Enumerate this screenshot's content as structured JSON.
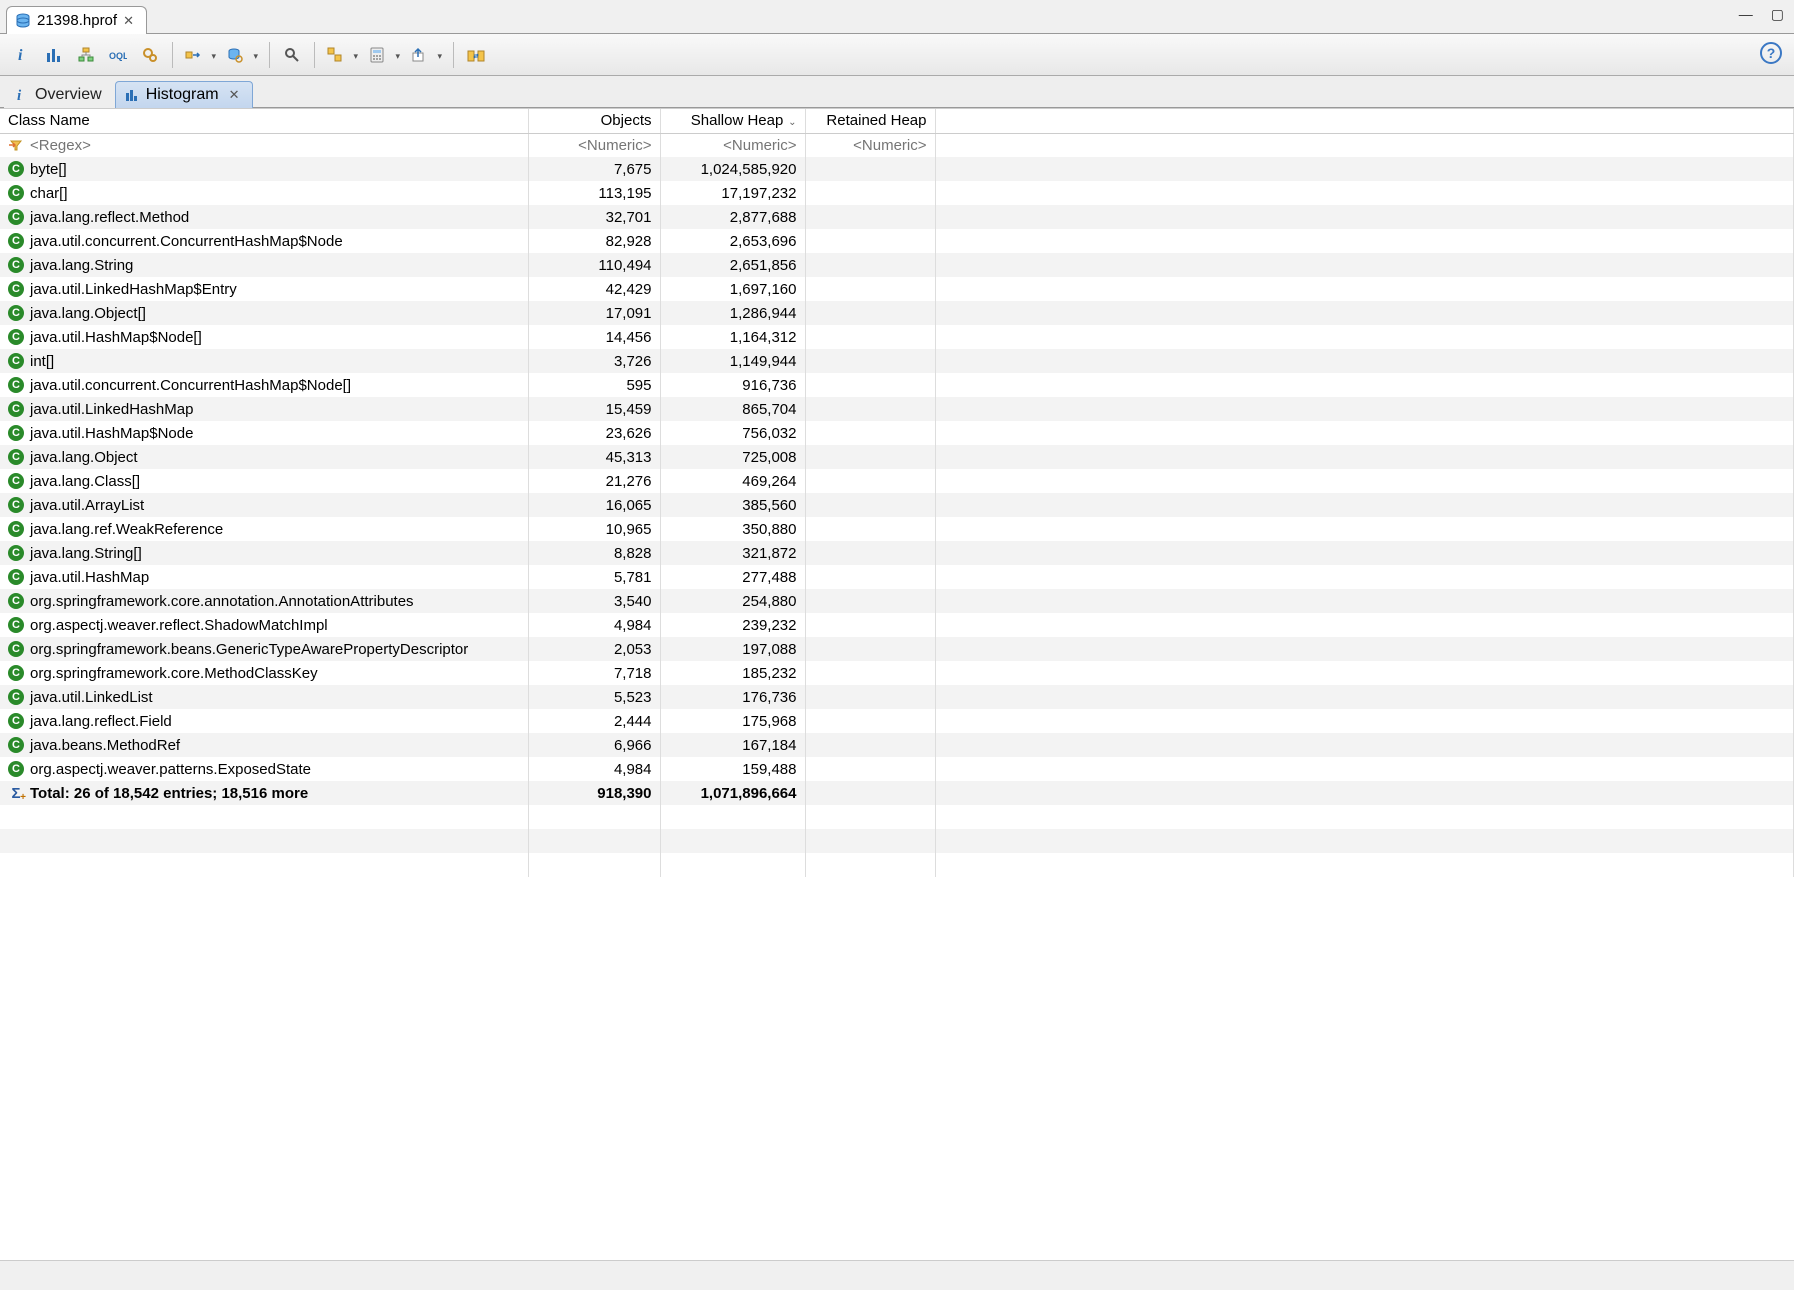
{
  "file_tab": {
    "title": "21398.hprof"
  },
  "subtabs": {
    "overview": "Overview",
    "histogram": "Histogram"
  },
  "columns": {
    "name": "Class Name",
    "objects": "Objects",
    "shallow": "Shallow Heap",
    "retained": "Retained Heap"
  },
  "filter": {
    "name_placeholder": "<Regex>",
    "numeric_placeholder": "<Numeric>"
  },
  "rows": [
    {
      "name": "byte[]",
      "objects": "7,675",
      "shallow": "1,024,585,920",
      "retained": ""
    },
    {
      "name": "char[]",
      "objects": "113,195",
      "shallow": "17,197,232",
      "retained": ""
    },
    {
      "name": "java.lang.reflect.Method",
      "objects": "32,701",
      "shallow": "2,877,688",
      "retained": ""
    },
    {
      "name": "java.util.concurrent.ConcurrentHashMap$Node",
      "objects": "82,928",
      "shallow": "2,653,696",
      "retained": ""
    },
    {
      "name": "java.lang.String",
      "objects": "110,494",
      "shallow": "2,651,856",
      "retained": ""
    },
    {
      "name": "java.util.LinkedHashMap$Entry",
      "objects": "42,429",
      "shallow": "1,697,160",
      "retained": ""
    },
    {
      "name": "java.lang.Object[]",
      "objects": "17,091",
      "shallow": "1,286,944",
      "retained": ""
    },
    {
      "name": "java.util.HashMap$Node[]",
      "objects": "14,456",
      "shallow": "1,164,312",
      "retained": ""
    },
    {
      "name": "int[]",
      "objects": "3,726",
      "shallow": "1,149,944",
      "retained": ""
    },
    {
      "name": "java.util.concurrent.ConcurrentHashMap$Node[]",
      "objects": "595",
      "shallow": "916,736",
      "retained": ""
    },
    {
      "name": "java.util.LinkedHashMap",
      "objects": "15,459",
      "shallow": "865,704",
      "retained": ""
    },
    {
      "name": "java.util.HashMap$Node",
      "objects": "23,626",
      "shallow": "756,032",
      "retained": ""
    },
    {
      "name": "java.lang.Object",
      "objects": "45,313",
      "shallow": "725,008",
      "retained": ""
    },
    {
      "name": "java.lang.Class[]",
      "objects": "21,276",
      "shallow": "469,264",
      "retained": ""
    },
    {
      "name": "java.util.ArrayList",
      "objects": "16,065",
      "shallow": "385,560",
      "retained": ""
    },
    {
      "name": "java.lang.ref.WeakReference",
      "objects": "10,965",
      "shallow": "350,880",
      "retained": ""
    },
    {
      "name": "java.lang.String[]",
      "objects": "8,828",
      "shallow": "321,872",
      "retained": ""
    },
    {
      "name": "java.util.HashMap",
      "objects": "5,781",
      "shallow": "277,488",
      "retained": ""
    },
    {
      "name": "org.springframework.core.annotation.AnnotationAttributes",
      "objects": "3,540",
      "shallow": "254,880",
      "retained": ""
    },
    {
      "name": "org.aspectj.weaver.reflect.ShadowMatchImpl",
      "objects": "4,984",
      "shallow": "239,232",
      "retained": ""
    },
    {
      "name": "org.springframework.beans.GenericTypeAwarePropertyDescriptor",
      "objects": "2,053",
      "shallow": "197,088",
      "retained": ""
    },
    {
      "name": "org.springframework.core.MethodClassKey",
      "objects": "7,718",
      "shallow": "185,232",
      "retained": ""
    },
    {
      "name": "java.util.LinkedList",
      "objects": "5,523",
      "shallow": "176,736",
      "retained": ""
    },
    {
      "name": "java.lang.reflect.Field",
      "objects": "2,444",
      "shallow": "175,968",
      "retained": ""
    },
    {
      "name": "java.beans.MethodRef",
      "objects": "6,966",
      "shallow": "167,184",
      "retained": ""
    },
    {
      "name": "org.aspectj.weaver.patterns.ExposedState",
      "objects": "4,984",
      "shallow": "159,488",
      "retained": ""
    }
  ],
  "total": {
    "label": "Total: 26 of 18,542 entries; 18,516 more",
    "objects": "918,390",
    "shallow": "1,071,896,664",
    "retained": ""
  }
}
